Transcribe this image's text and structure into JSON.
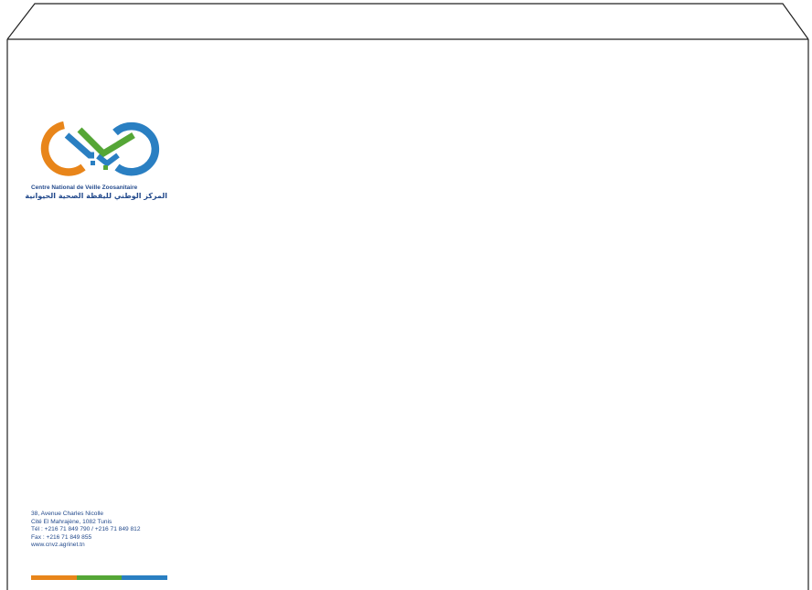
{
  "organization": {
    "name_fr": "Centre National de Veille Zoosanitaire",
    "name_ar": "المركز الوطني لليقظة الصحية الحيوانية"
  },
  "logo": {
    "icon": "infinity-logo-icon",
    "colors": {
      "orange": "#e8851a",
      "green": "#55a636",
      "blue": "#2a7fc2"
    }
  },
  "address": {
    "street": "38, Avenue Charles Nicolle",
    "city": "Cité El Mahrajène, 1082 Tunis",
    "phone": "Tél  : +216 71 849 790 / +216 71 849 812",
    "fax": "Fax : +216 71 849 855",
    "website": "www.cnvz.agrinet.tn"
  },
  "brand_bar": [
    "#e8851a",
    "#55a636",
    "#2a7fc2"
  ],
  "text_color": "#234a8c",
  "outline_color": "#222222"
}
